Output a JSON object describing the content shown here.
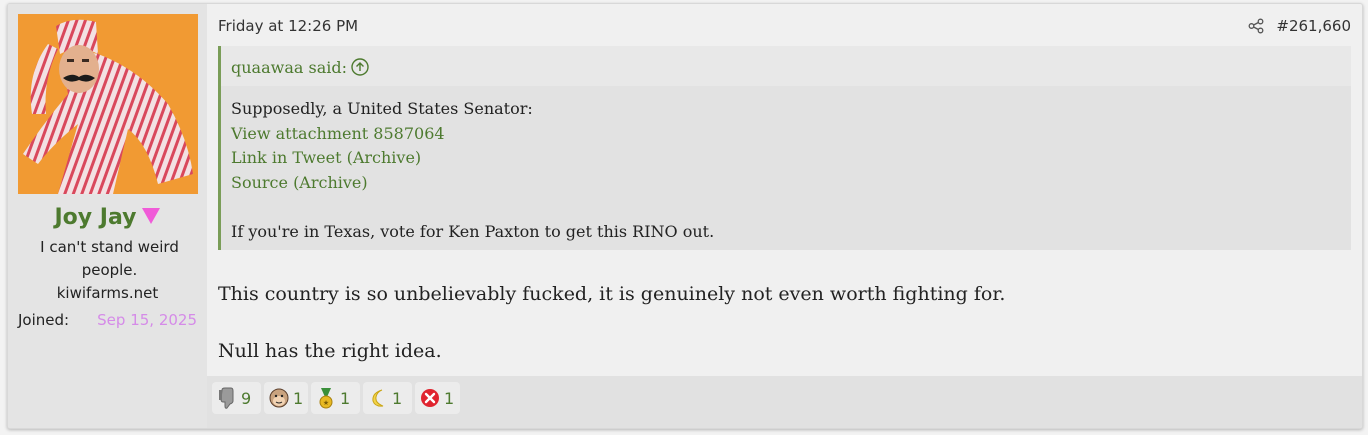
{
  "user": {
    "name": "Joy Jay",
    "title": "I can't stand weird people.",
    "site": "kiwifarms.net",
    "joined_label": "Joined:",
    "joined_value": "Sep 15, 2025"
  },
  "post": {
    "date": "Friday at 12:26 PM",
    "number": "#261,660"
  },
  "quote": {
    "author": "quaawaa said:",
    "intro": "Supposedly, a United States Senator:",
    "links": [
      "View attachment 8587064",
      "Link in Tweet (Archive)",
      "Source (Archive)"
    ],
    "footer": "If you're in Texas, vote for Ken Paxton to get this RINO out."
  },
  "message": {
    "line1": "This country is so unbelievably fucked, it is genuinely not even worth fighting for.",
    "line2": "Null has the right idea."
  },
  "reactions": [
    {
      "icon": "thumbs-down-icon",
      "count": "9"
    },
    {
      "icon": "monkey-face-icon",
      "count": "1"
    },
    {
      "icon": "medal-icon",
      "count": "1"
    },
    {
      "icon": "crescent-moon-icon",
      "count": "1"
    },
    {
      "icon": "red-x-icon",
      "count": "1"
    }
  ],
  "colors": {
    "username": "#4d7a2f",
    "link": "#4d7a2f",
    "joined_date": "#d58be8",
    "quote_border": "#7a9d58"
  }
}
